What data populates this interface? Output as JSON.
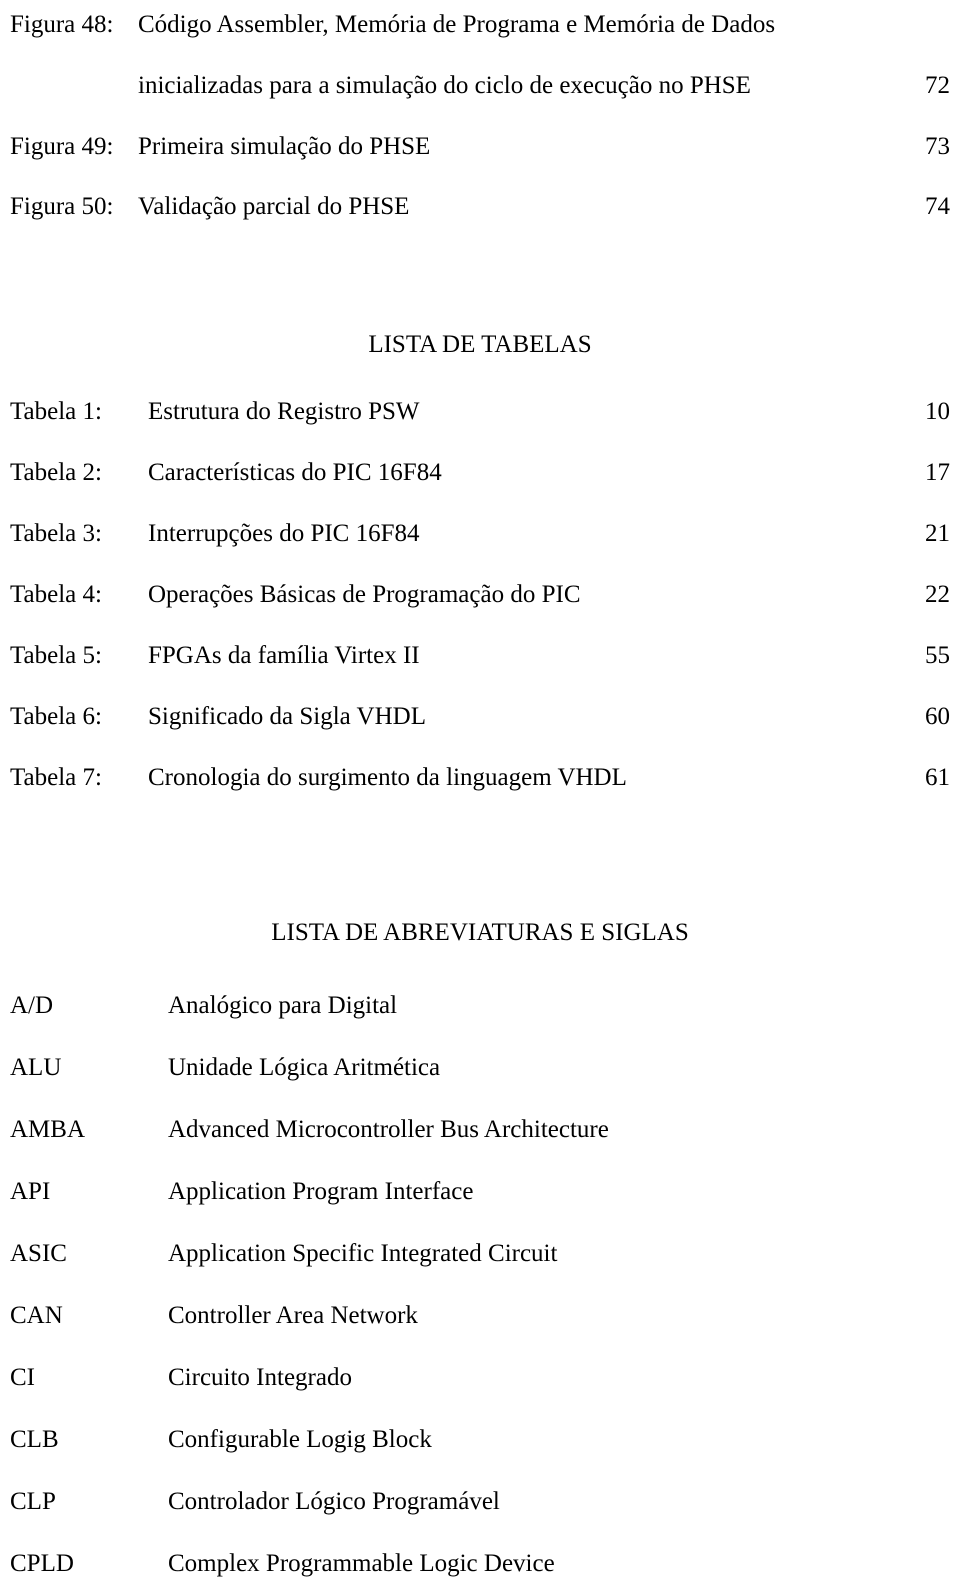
{
  "figure_list": {
    "entries": [
      {
        "label": "Figura 48:",
        "desc": "Código Assembler, Memória de Programa e Memória de Dados",
        "continuation": "inicializadas para a simulação do ciclo de execução no PHSE",
        "page": "72"
      },
      {
        "label": "Figura 49:",
        "desc": "Primeira simulação do PHSE",
        "page": "73"
      },
      {
        "label": "Figura 50:",
        "desc": "Validação parcial do PHSE",
        "page": "74"
      }
    ]
  },
  "table_list": {
    "heading": "LISTA DE TABELAS",
    "entries": [
      {
        "label": "Tabela 1:",
        "desc": "Estrutura do Registro PSW",
        "page": "10"
      },
      {
        "label": "Tabela 2:",
        "desc": "Características do PIC 16F84",
        "page": "17"
      },
      {
        "label": "Tabela 3:",
        "desc": "Interrupções do PIC 16F84",
        "page": "21"
      },
      {
        "label": "Tabela 4:",
        "desc": "Operações Básicas de Programação do PIC",
        "page": "22"
      },
      {
        "label": "Tabela 5:",
        "desc": "FPGAs da família Virtex II",
        "page": "55"
      },
      {
        "label": "Tabela 6:",
        "desc": "Significado da Sigla VHDL",
        "page": "60"
      },
      {
        "label": "Tabela 7:",
        "desc": "Cronologia do surgimento da linguagem VHDL",
        "page": "61"
      }
    ]
  },
  "abbreviation_list": {
    "heading": "LISTA DE ABREVIATURAS E SIGLAS",
    "entries": [
      {
        "abbr": "A/D",
        "meaning": "Analógico para Digital"
      },
      {
        "abbr": "ALU",
        "meaning": "Unidade Lógica Aritmética"
      },
      {
        "abbr": "AMBA",
        "meaning": "Advanced Microcontroller Bus Architecture"
      },
      {
        "abbr": "API",
        "meaning": "Application Program Interface"
      },
      {
        "abbr": "ASIC",
        "meaning": "Application Specific Integrated Circuit"
      },
      {
        "abbr": "CAN",
        "meaning": "Controller Area Network"
      },
      {
        "abbr": "CI",
        "meaning": "Circuito Integrado"
      },
      {
        "abbr": "CLB",
        "meaning": "Configurable Logig Block"
      },
      {
        "abbr": "CLP",
        "meaning": "Controlador Lógico Programável"
      },
      {
        "abbr": "CPLD",
        "meaning": "Complex Programmable Logic Device"
      }
    ]
  }
}
